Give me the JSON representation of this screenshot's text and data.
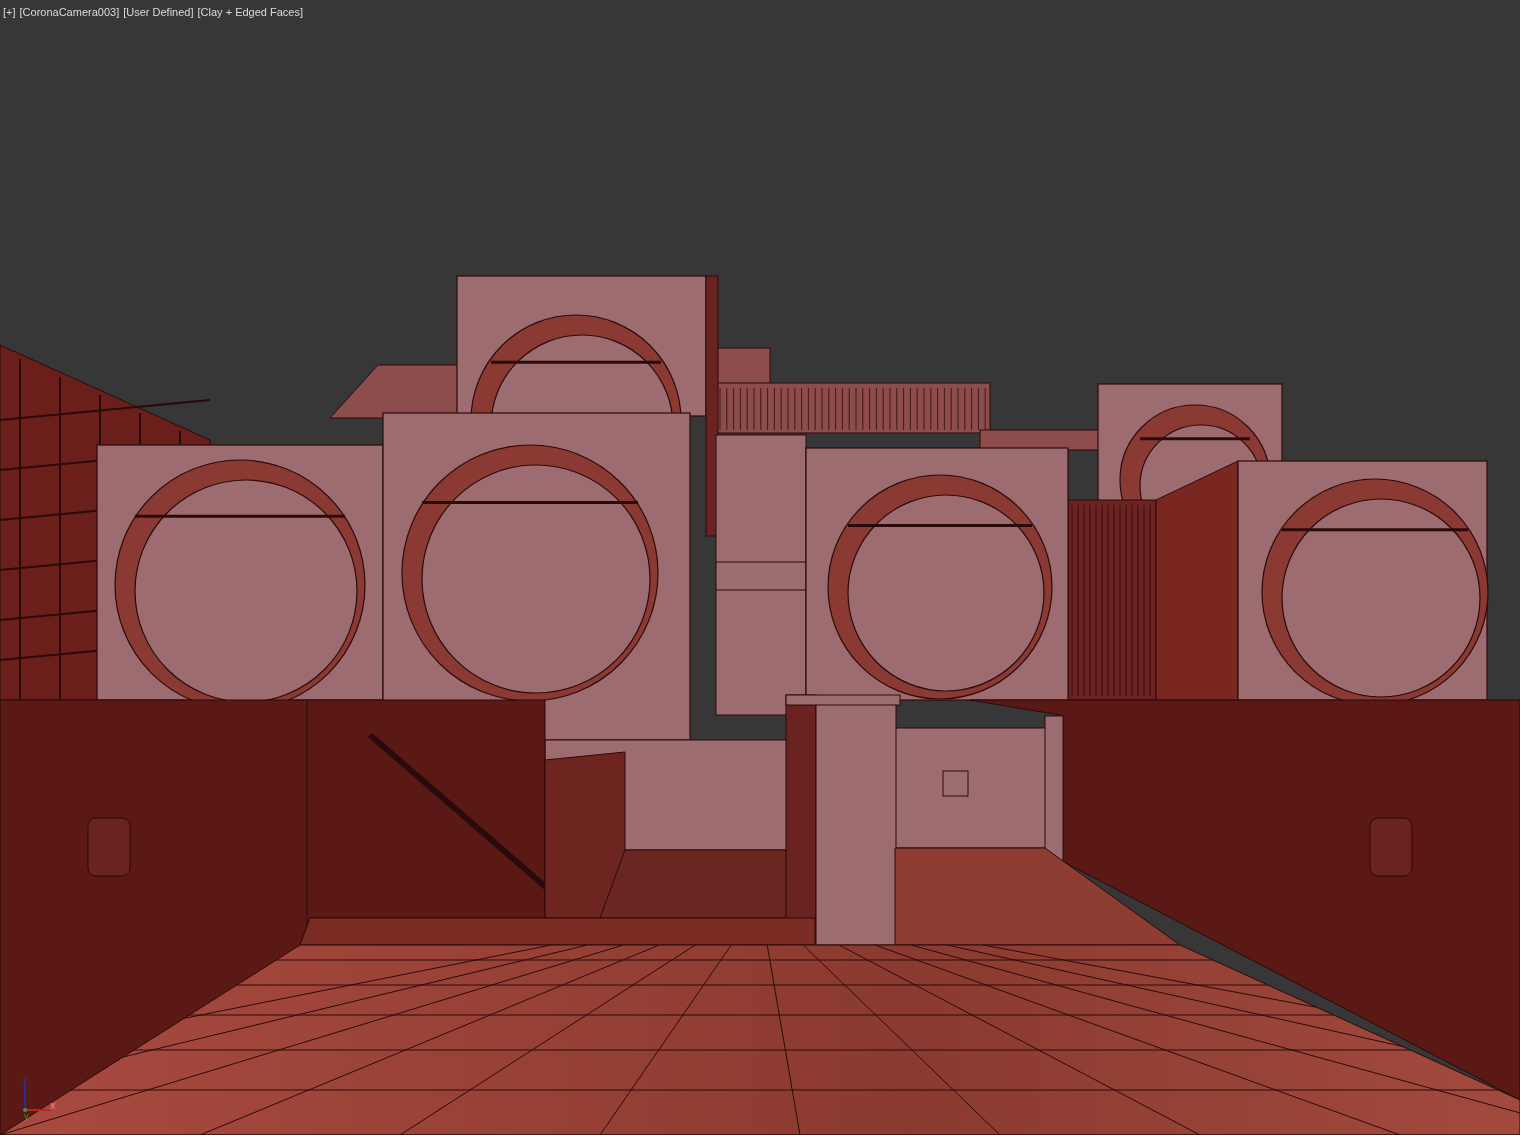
{
  "viewport": {
    "labels": [
      "[+]",
      "[CoronaCamera003]",
      "[User Defined]",
      "[Clay + Edged Faces]"
    ],
    "axis_labels": [
      "z",
      "x",
      "y"
    ]
  }
}
